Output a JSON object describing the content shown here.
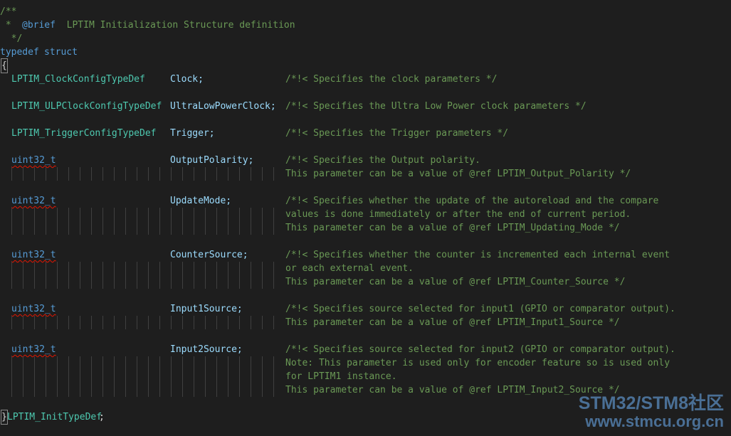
{
  "editor": {
    "comment_open": "/**",
    "comment_star": " * ",
    "brief_tag": "@brief",
    "brief_text": "  LPTIM Initialization Structure definition",
    "comment_close": "  */",
    "typedef_kw": "typedef",
    "struct_kw": "struct",
    "open_brace": "{",
    "close_brace": "}",
    "typedef_name": "LPTIM_InitTypeDef",
    "semicolon": ";",
    "members": [
      {
        "type": "LPTIM_ClockConfigTypeDef",
        "name": "Clock;",
        "comment": [
          "/*!< Specifies the clock parameters */"
        ]
      },
      {
        "type": "LPTIM_ULPClockConfigTypeDef",
        "name": "UltraLowPowerClock;",
        "comment": [
          "/*!< Specifies the Ultra Low Power clock parameters */"
        ]
      },
      {
        "type": "LPTIM_TriggerConfigTypeDef",
        "name": "Trigger;",
        "comment": [
          "/*!< Specifies the Trigger parameters */"
        ]
      },
      {
        "type": "uint32_t",
        "name": "OutputPolarity;",
        "comment": [
          "/*!< Specifies the Output polarity.",
          "This parameter can be a value of @ref LPTIM_Output_Polarity */"
        ]
      },
      {
        "type": "uint32_t",
        "name": "UpdateMode;",
        "comment": [
          "/*!< Specifies whether the update of the autoreload and the compare",
          "values is done immediately or after the end of current period.",
          "This parameter can be a value of @ref LPTIM_Updating_Mode */"
        ]
      },
      {
        "type": "uint32_t",
        "name": "CounterSource;",
        "comment": [
          "/*!< Specifies whether the counter is incremented each internal event",
          "or each external event.",
          "This parameter can be a value of @ref LPTIM_Counter_Source */"
        ]
      },
      {
        "type": "uint32_t",
        "name": "Input1Source;",
        "comment": [
          "/*!< Specifies source selected for input1 (GPIO or comparator output).",
          "This parameter can be a value of @ref LPTIM_Input1_Source */"
        ]
      },
      {
        "type": "uint32_t",
        "name": "Input2Source;",
        "comment": [
          "/*!< Specifies source selected for input2 (GPIO or comparator output).",
          "Note: This parameter is used only for encoder feature so is used only",
          "for LPTIM1 instance.",
          "This parameter can be a value of @ref LPTIM_Input2_Source */"
        ]
      }
    ]
  },
  "watermark": {
    "line1": "STM32/STM8社区",
    "line2": "www.stmcu.org.cn"
  }
}
